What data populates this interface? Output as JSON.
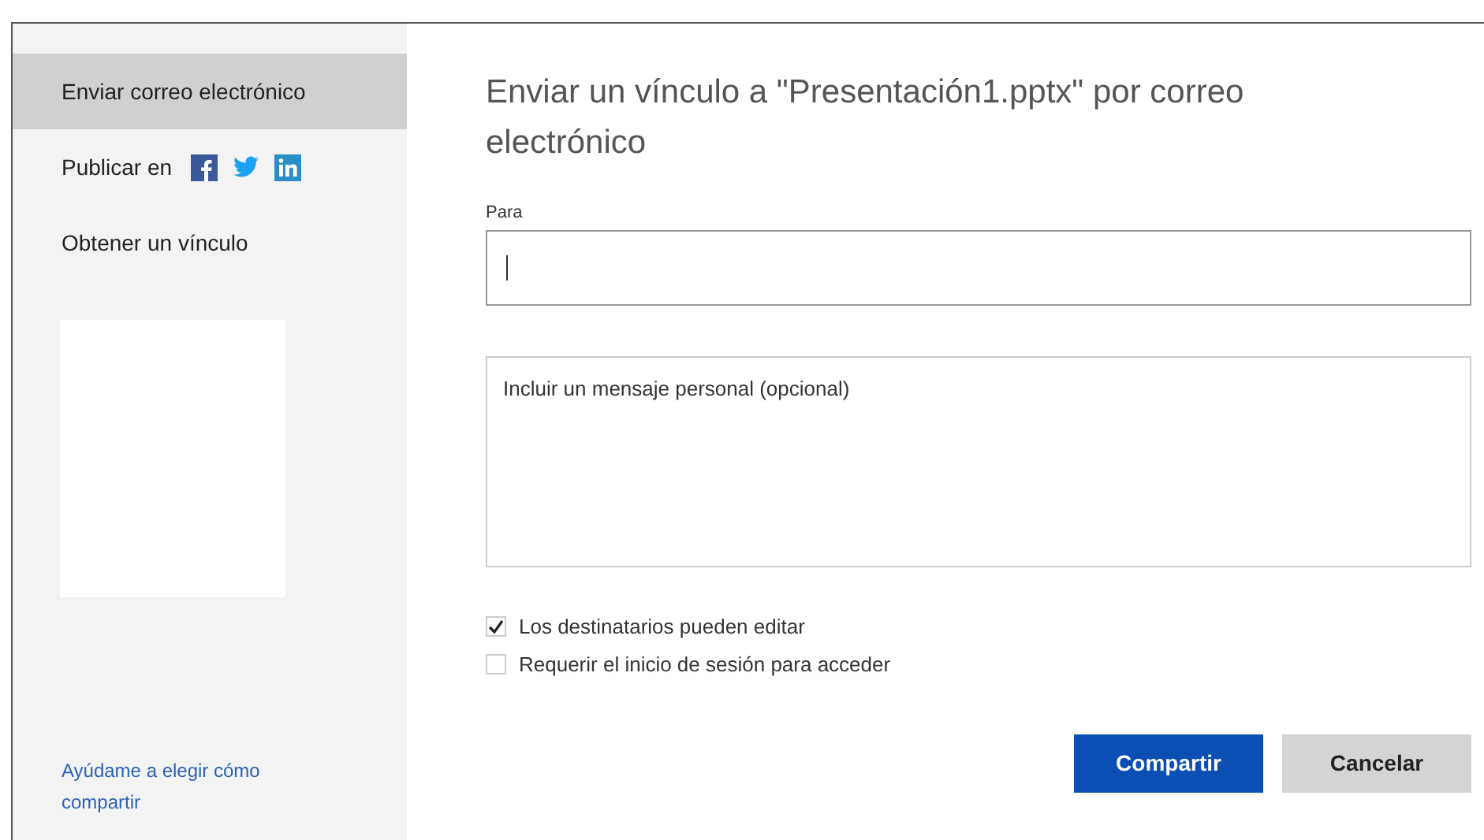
{
  "sidebar": {
    "items": [
      {
        "kind": "text",
        "label": "Enviar correo electrónico",
        "selected": true
      },
      {
        "kind": "social",
        "label": "Publicar en",
        "selected": false
      },
      {
        "kind": "text",
        "label": "Obtener un vínculo",
        "selected": false
      }
    ],
    "help_link": "Ayúdame a elegir cómo compartir"
  },
  "title": "Enviar un vínculo a \"Presentación1.pptx\" por correo electrónico",
  "to_field": {
    "label": "Para"
  },
  "message_field": {
    "placeholder": "Incluir un mensaje personal (opcional)"
  },
  "options": [
    {
      "label": "Los destinatarios pueden editar",
      "checked": true
    },
    {
      "label": "Requerir el inicio de sesión para acceder",
      "checked": false
    }
  ],
  "buttons": [
    {
      "kind": "primary",
      "label": "Compartir"
    },
    {
      "kind": "secondary",
      "label": "Cancelar"
    }
  ]
}
